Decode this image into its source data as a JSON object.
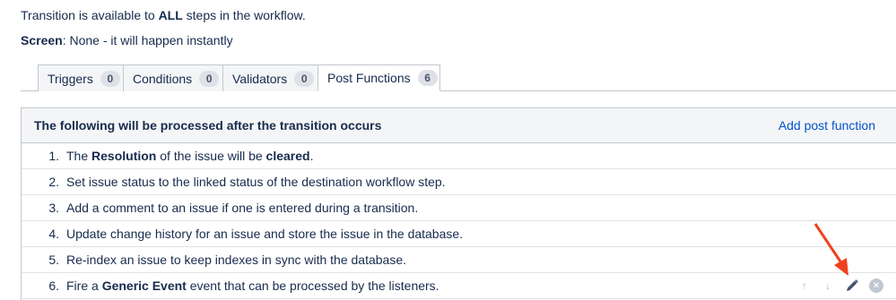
{
  "info": {
    "line1": {
      "prefix": "Transition is available to ",
      "strong": "ALL",
      "suffix": " steps in the workflow."
    },
    "line2": {
      "label": "Screen",
      "value": ": None - it will happen instantly"
    }
  },
  "tabs": [
    {
      "label": "Triggers",
      "count": "0",
      "active": false
    },
    {
      "label": "Conditions",
      "count": "0",
      "active": false
    },
    {
      "label": "Validators",
      "count": "0",
      "active": false
    },
    {
      "label": "Post Functions",
      "count": "6",
      "active": true
    }
  ],
  "panel": {
    "title": "The following will be processed after the transition occurs",
    "add_label": "Add post function"
  },
  "post_functions": [
    {
      "num": "1.",
      "pre": "The ",
      "b1": "Resolution",
      "mid": " of the issue will be ",
      "b2": "cleared",
      "post": "."
    },
    {
      "num": "2.",
      "text": "Set issue status to the linked status of the destination workflow step."
    },
    {
      "num": "3.",
      "text": "Add a comment to an issue if one is entered during a transition."
    },
    {
      "num": "4.",
      "text": "Update change history for an issue and store the issue in the database."
    },
    {
      "num": "5.",
      "text": "Re-index an issue to keep indexes in sync with the database."
    },
    {
      "num": "6.",
      "pre": "Fire a ",
      "b1": "Generic Event",
      "post": " event that can be processed by the listeners."
    }
  ],
  "colors": {
    "link": "#0052cc",
    "annotation_arrow": "#f0411e",
    "header_bg": "#f4f5f7"
  },
  "icons": {
    "move_up": "arrow-up-icon",
    "move_down": "arrow-down-icon",
    "edit": "pencil-icon",
    "delete": "remove-circle-icon"
  }
}
